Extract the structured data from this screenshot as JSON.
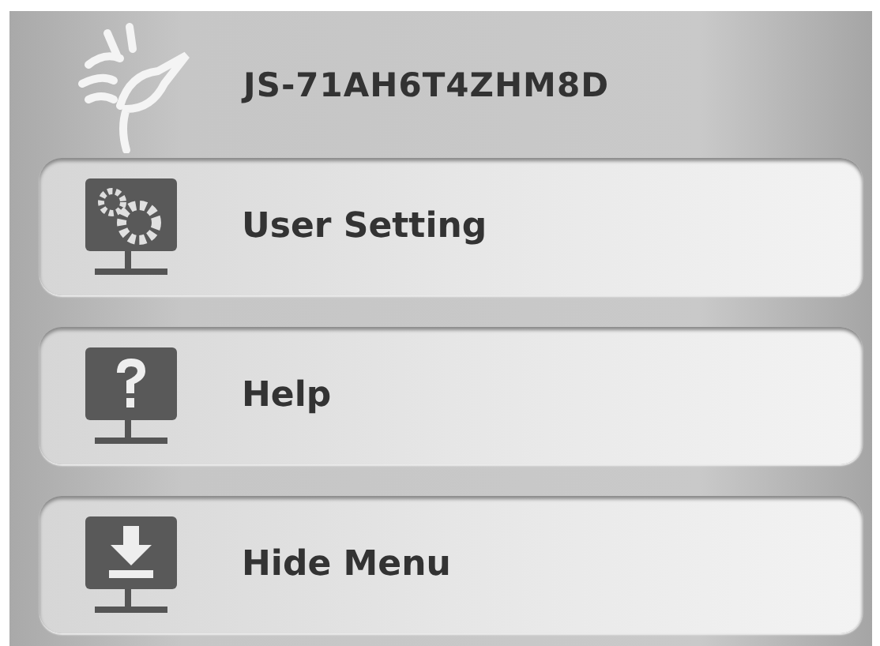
{
  "header": {
    "device_name": "JS-71AH6T4ZHM8D"
  },
  "menu_items": [
    {
      "kind": "settings",
      "label": "User Setting"
    },
    {
      "kind": "help",
      "label": "Help"
    },
    {
      "kind": "hide",
      "label": "Hide Menu"
    }
  ]
}
